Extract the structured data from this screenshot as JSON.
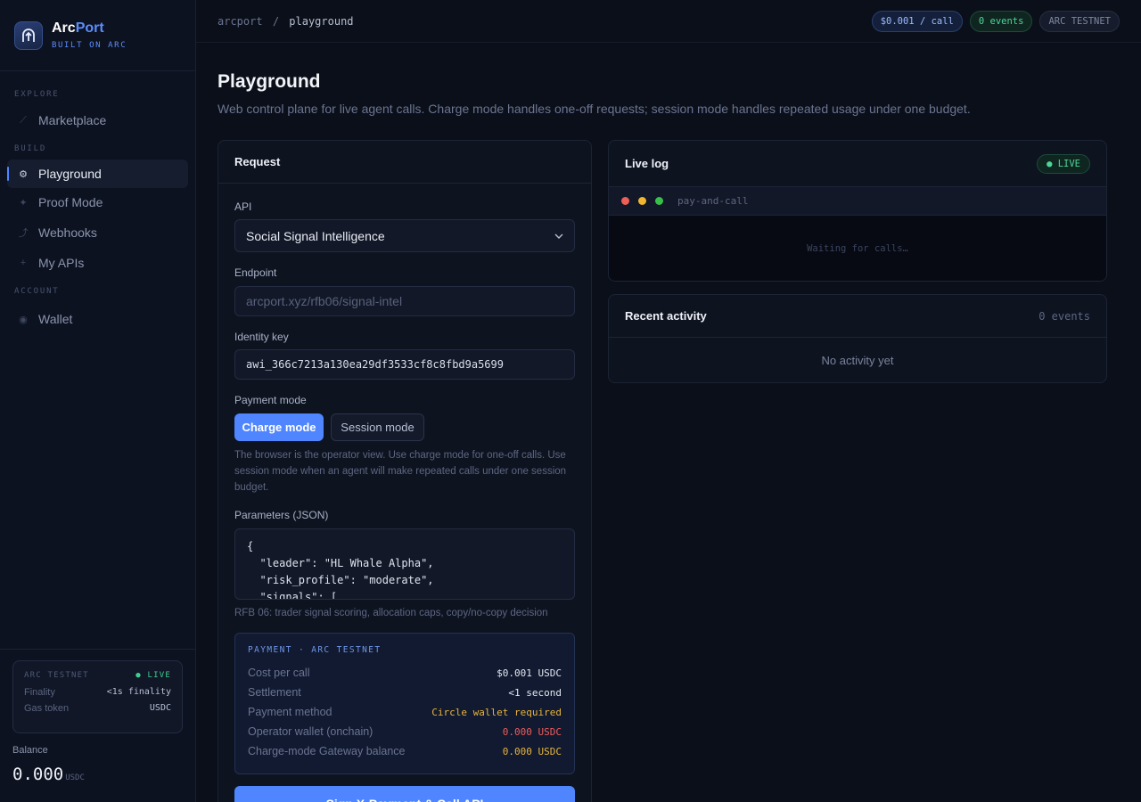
{
  "brand": {
    "name_a": "Arc",
    "name_b": "Port",
    "tagline": "BUILT ON ARC"
  },
  "nav": {
    "sections": {
      "explore": "EXPLORE",
      "build": "BUILD",
      "account": "ACCOUNT"
    },
    "items": [
      {
        "label": "Marketplace",
        "icon": "trend-icon"
      },
      {
        "label": "Playground",
        "icon": "gear-icon"
      },
      {
        "label": "Proof Mode",
        "icon": "sparkle-icon"
      },
      {
        "label": "Webhooks",
        "icon": "hook-icon"
      },
      {
        "label": "My APIs",
        "icon": "plus-icon"
      },
      {
        "label": "Wallet",
        "icon": "wallet-icon"
      }
    ]
  },
  "network": {
    "label": "ARC TESTNET",
    "status": "● LIVE",
    "finality_label": "Finality",
    "finality_value": "<1s finality",
    "gas_label": "Gas token",
    "gas_value": "USDC"
  },
  "balance": {
    "label": "Balance",
    "value": "0.000",
    "unit": "USDC"
  },
  "topbar": {
    "crumb_root": "arcport",
    "crumb_sep": "/",
    "crumb_current": "playground",
    "price_pill": "$0.001 / call",
    "events_pill": "0 events",
    "network_pill": "ARC TESTNET"
  },
  "page": {
    "title": "Playground",
    "subtitle": "Web control plane for live agent calls. Charge mode handles one-off requests; session mode handles repeated usage under one budget."
  },
  "request": {
    "title": "Request",
    "api_label": "API",
    "api_value": "Social Signal Intelligence",
    "endpoint_label": "Endpoint",
    "endpoint_placeholder": "arcport.xyz/rfb06/signal-intel",
    "identity_label": "Identity key",
    "identity_value": "awi_366c7213a130ea29df3533cf8c8fbd9a5699",
    "payment_mode_label": "Payment mode",
    "charge_mode": "Charge mode",
    "session_mode": "Session mode",
    "mode_hint": "The browser is the operator view. Use charge mode for one-off calls. Use session mode when an agent will make repeated calls under one session budget.",
    "params_label": "Parameters (JSON)",
    "params_value": "{\n  \"leader\": \"HL Whale Alpha\",\n  \"risk_profile\": \"moderate\",\n  \"signals\": [",
    "params_hint": "RFB 06: trader signal scoring, allocation caps, copy/no-copy decision",
    "cta": "Sign X-Payment & Call API"
  },
  "payment": {
    "header": "PAYMENT · ARC TESTNET",
    "rows": [
      {
        "label": "Cost per call",
        "value": "$0.001 USDC"
      },
      {
        "label": "Settlement",
        "value": "<1 second"
      },
      {
        "label": "Payment method",
        "value": "Circle wallet required"
      },
      {
        "label": "Operator wallet (onchain)",
        "value": "0.000 USDC"
      },
      {
        "label": "Charge-mode Gateway balance",
        "value": "0.000 USDC"
      }
    ],
    "colors": {
      "warn": "#e9b53b",
      "danger": "#ef5b5b"
    }
  },
  "log": {
    "title": "Live log",
    "live": "● LIVE",
    "terminal_title": "pay-and-call",
    "empty": "Waiting for calls…"
  },
  "activity": {
    "title": "Recent activity",
    "count": "0 events",
    "empty": "No activity yet"
  },
  "colors": {
    "accent": "#4f86ff",
    "live": "#4fd49a",
    "bg": "#0b0f19"
  }
}
